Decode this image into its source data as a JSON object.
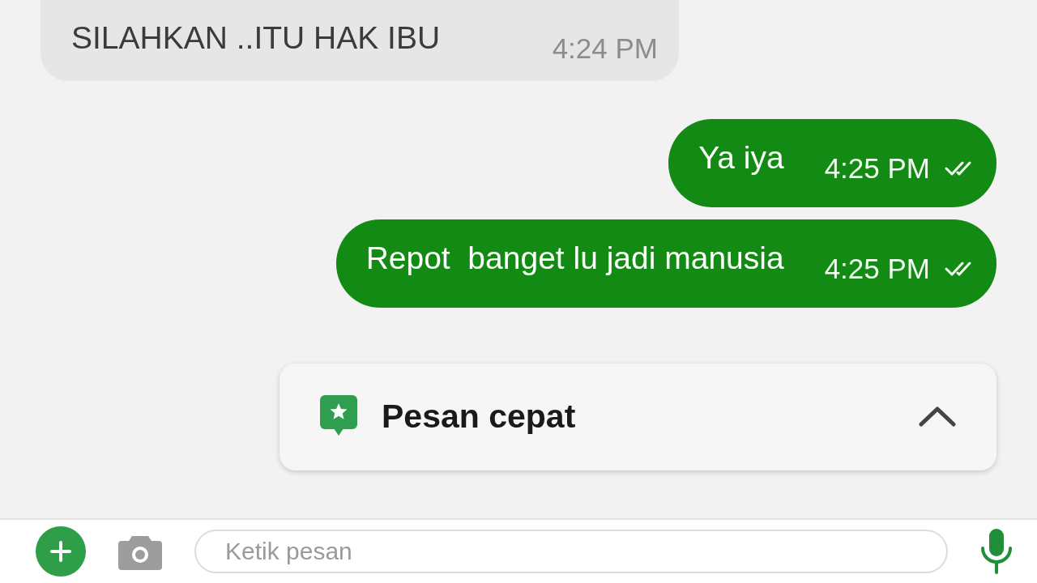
{
  "messages": [
    {
      "kind": "incoming",
      "text": "SILAHKAN ..ITU HAK IBU",
      "time": "4:24 PM"
    },
    {
      "kind": "outgoing",
      "text": "Ya iya",
      "time": "4:25 PM",
      "delivered": true
    },
    {
      "kind": "outgoing",
      "text": "Repot  banget lu jadi manusia",
      "time": "4:25 PM",
      "delivered": true
    }
  ],
  "quick_reply": {
    "title": "Pesan cepat",
    "expanded": false
  },
  "composer": {
    "placeholder": "Ketik pesan"
  }
}
